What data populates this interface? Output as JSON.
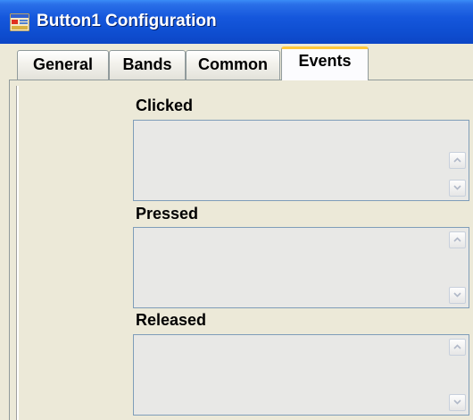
{
  "window": {
    "title": "Button1 Configuration",
    "icon": "app-window-icon"
  },
  "tabs": [
    {
      "label": "General",
      "active": false
    },
    {
      "label": "Bands",
      "active": false
    },
    {
      "label": "Common",
      "active": false
    },
    {
      "label": "Events",
      "active": true
    }
  ],
  "events": {
    "clicked": {
      "label": "Clicked",
      "value": ""
    },
    "pressed": {
      "label": "Pressed",
      "value": ""
    },
    "released": {
      "label": "Released",
      "value": ""
    }
  },
  "colors": {
    "title_bar": "#0C46C6",
    "active_tab_accent": "#FFC83C",
    "dialog_bg": "#ECE9D8"
  }
}
